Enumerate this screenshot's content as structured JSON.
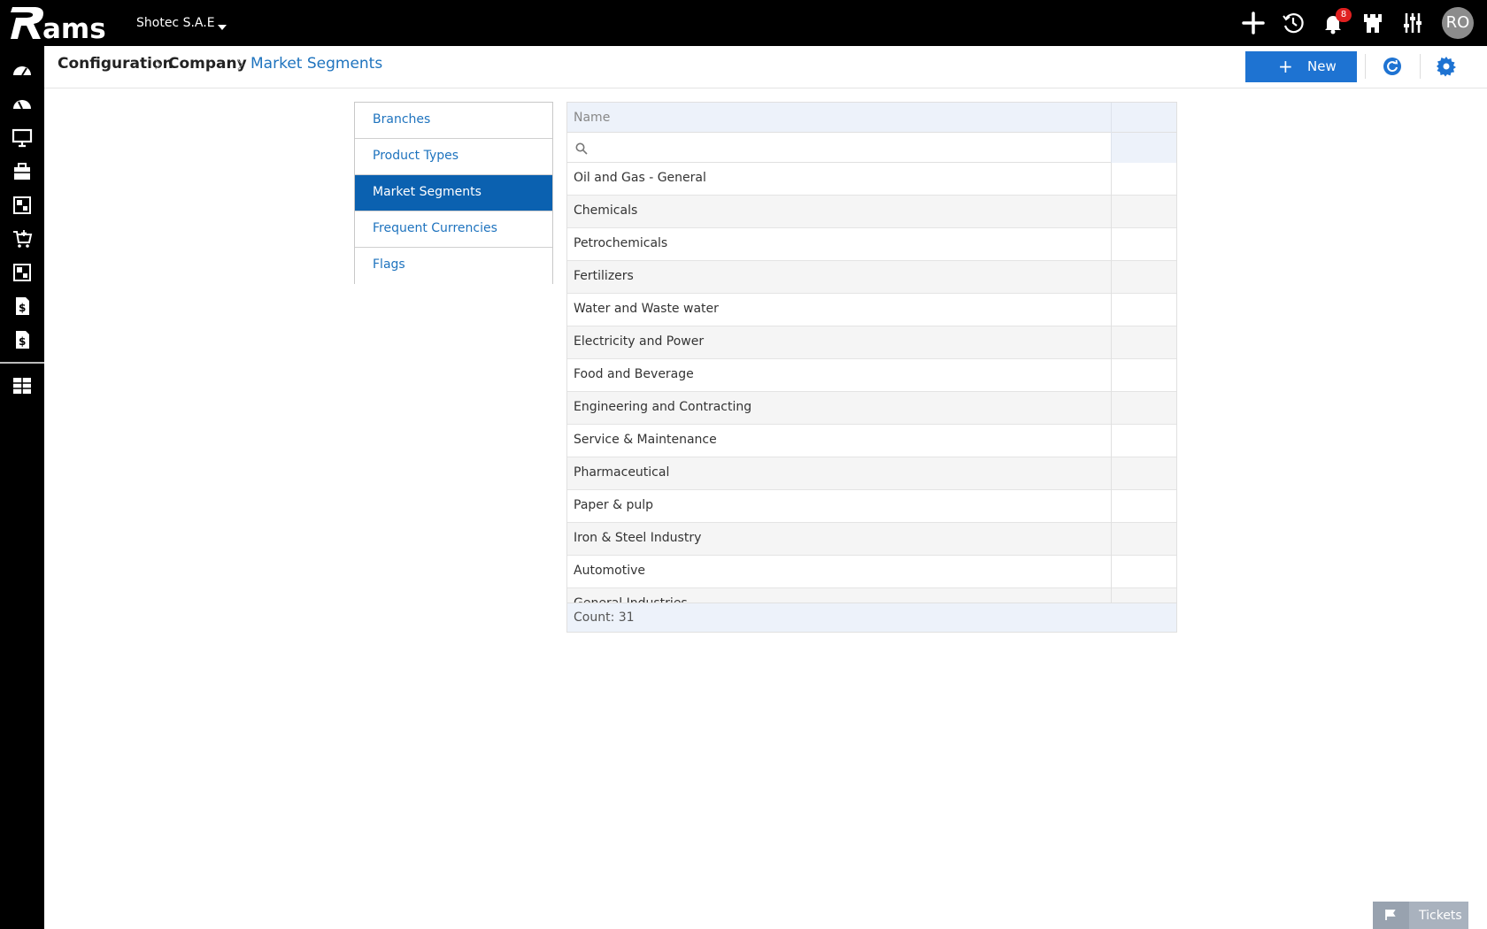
{
  "app": {
    "logo_text": "Rams",
    "company": "Shotec S.A.E",
    "notification_count": "8",
    "user_initials": "RO"
  },
  "breadcrumb": {
    "items": [
      "Configuration",
      "Company",
      "Market Segments"
    ]
  },
  "toolbar": {
    "new_label": "New"
  },
  "nav": {
    "items": [
      {
        "label": "Branches",
        "active": false
      },
      {
        "label": "Product Types",
        "active": false
      },
      {
        "label": "Market Segments",
        "active": true
      },
      {
        "label": "Frequent Currencies",
        "active": false
      },
      {
        "label": "Flags",
        "active": false
      }
    ]
  },
  "grid": {
    "column_header": "Name",
    "filter_value": "",
    "rows": [
      "Oil and Gas - General",
      "Chemicals",
      "Petrochemicals",
      "Fertilizers",
      "Water and Waste water",
      "Electricity and Power",
      "Food and Beverage",
      "Engineering and Contracting",
      "Service & Maintenance",
      "Pharmaceutical",
      "Paper & pulp",
      "Iron & Steel Industry",
      "Automotive",
      "General Industries"
    ],
    "count_label": "Count: 31"
  },
  "tickets": {
    "label": "Tickets"
  },
  "icons": {
    "top": [
      "plus-icon",
      "history-icon",
      "bell-icon",
      "castle-icon",
      "sliders-icon"
    ],
    "sidebar": [
      "dashboard-icon",
      "dashboard-2-icon",
      "monitor-icon",
      "briefcase-icon",
      "layout-icon",
      "cart-icon",
      "layout-2-icon",
      "invoice-icon",
      "invoice-2-icon",
      "reports-icon"
    ],
    "header": [
      "refresh-icon",
      "settings-icon"
    ]
  },
  "colors": {
    "accent": "#1e73d2",
    "active_nav": "#0b61b0",
    "topbar": "#000000"
  }
}
